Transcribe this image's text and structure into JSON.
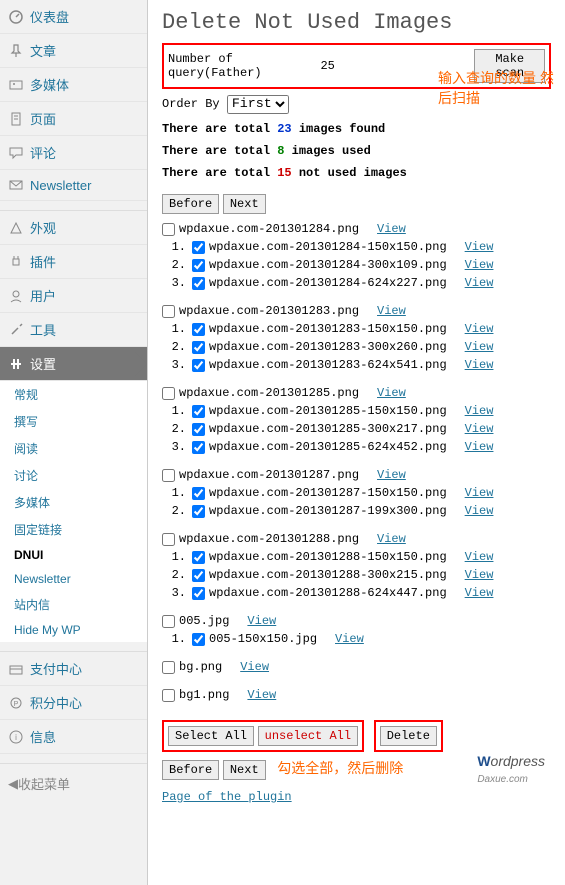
{
  "sidebar": {
    "items": [
      {
        "label": "仪表盘",
        "icon": "dashboard"
      },
      {
        "label": "文章",
        "icon": "pin"
      },
      {
        "label": "多媒体",
        "icon": "media"
      },
      {
        "label": "页面",
        "icon": "page"
      },
      {
        "label": "评论",
        "icon": "comment"
      },
      {
        "label": "Newsletter",
        "icon": "mail"
      }
    ],
    "items2": [
      {
        "label": "外观",
        "icon": "appearance"
      },
      {
        "label": "插件",
        "icon": "plugin"
      },
      {
        "label": "用户",
        "icon": "users"
      },
      {
        "label": "工具",
        "icon": "tools"
      },
      {
        "label": "设置",
        "icon": "settings",
        "active": true
      }
    ],
    "sub": [
      "常规",
      "撰写",
      "阅读",
      "讨论",
      "多媒体",
      "固定链接",
      "DNUI",
      "Newsletter",
      "站内信",
      "Hide My WP"
    ],
    "sub_current": "DNUI",
    "items3": [
      {
        "label": "支付中心",
        "icon": "pay"
      },
      {
        "label": "积分中心",
        "icon": "points"
      },
      {
        "label": "信息",
        "icon": "info"
      }
    ],
    "collapse": "收起菜单"
  },
  "page": {
    "title": "Delete Not Used Images",
    "query_label": "Number of query(Father)",
    "query_value": "25",
    "scan_btn": "Make scan",
    "order_label": "Order By",
    "order_value": "First",
    "annotation1": "输入查询的数量 然后扫描",
    "stats": {
      "found_pre": "There are total ",
      "found_num": "23",
      "found_post": " images found",
      "used_pre": "There are total ",
      "used_num": "8",
      "used_post": " images used",
      "notused_pre": "There are total ",
      "notused_num": "15",
      "notused_post": " not used images"
    },
    "nav": {
      "before": "Before",
      "next": "Next"
    },
    "view": "View",
    "groups": [
      {
        "parent": {
          "name": "wpdaxue.com-201301284.png",
          "checked": false
        },
        "children": [
          {
            "name": "wpdaxue.com-201301284-150x150.png",
            "checked": true
          },
          {
            "name": "wpdaxue.com-201301284-300x109.png",
            "checked": true
          },
          {
            "name": "wpdaxue.com-201301284-624x227.png",
            "checked": true
          }
        ]
      },
      {
        "parent": {
          "name": "wpdaxue.com-201301283.png",
          "checked": false
        },
        "children": [
          {
            "name": "wpdaxue.com-201301283-150x150.png",
            "checked": true
          },
          {
            "name": "wpdaxue.com-201301283-300x260.png",
            "checked": true
          },
          {
            "name": "wpdaxue.com-201301283-624x541.png",
            "checked": true
          }
        ]
      },
      {
        "parent": {
          "name": "wpdaxue.com-201301285.png",
          "checked": false
        },
        "children": [
          {
            "name": "wpdaxue.com-201301285-150x150.png",
            "checked": true
          },
          {
            "name": "wpdaxue.com-201301285-300x217.png",
            "checked": true
          },
          {
            "name": "wpdaxue.com-201301285-624x452.png",
            "checked": true
          }
        ]
      },
      {
        "parent": {
          "name": "wpdaxue.com-201301287.png",
          "checked": false
        },
        "children": [
          {
            "name": "wpdaxue.com-201301287-150x150.png",
            "checked": true
          },
          {
            "name": "wpdaxue.com-201301287-199x300.png",
            "checked": true
          }
        ]
      },
      {
        "parent": {
          "name": "wpdaxue.com-201301288.png",
          "checked": false
        },
        "children": [
          {
            "name": "wpdaxue.com-201301288-150x150.png",
            "checked": true
          },
          {
            "name": "wpdaxue.com-201301288-300x215.png",
            "checked": true
          },
          {
            "name": "wpdaxue.com-201301288-624x447.png",
            "checked": true
          }
        ]
      },
      {
        "parent": {
          "name": "005.jpg",
          "checked": false
        },
        "children": [
          {
            "name": "005-150x150.jpg",
            "checked": true
          }
        ]
      },
      {
        "parent": {
          "name": "bg.png",
          "checked": false
        },
        "children": []
      },
      {
        "parent": {
          "name": "bg1.png",
          "checked": false
        },
        "children": []
      }
    ],
    "select_all": "Select All",
    "unselect_all": "unselect All",
    "delete": "Delete",
    "annotation2": "勾选全部，然后删除",
    "page_link": "Page of the plugin"
  }
}
